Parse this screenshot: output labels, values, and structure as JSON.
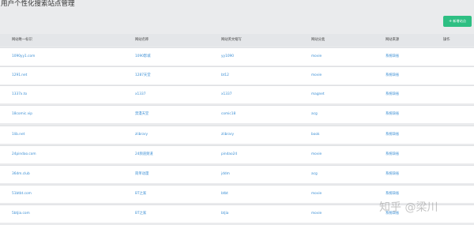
{
  "page": {
    "title": "用户个性化搜索站点管理"
  },
  "toolbar": {
    "add_label": "新增站点"
  },
  "table": {
    "columns": [
      "网站唯一标识",
      "网站名称",
      "网站英文缩写",
      "网站分类",
      "网站来源",
      "操作"
    ],
    "rows": [
      [
        "1090yy1.com",
        "1090影城",
        "yy1090",
        "movie",
        "系统缺省",
        ""
      ],
      [
        "1291.net",
        "1287天堂",
        "bt12",
        "movie",
        "系统缺省",
        ""
      ],
      [
        "1337x.to",
        "x1337",
        "x1337",
        "magnet",
        "系统缺省",
        ""
      ],
      [
        "18comic.vip",
        "禁漫天堂",
        "comic18",
        "acg",
        "系统缺省",
        ""
      ],
      [
        "1lib.net",
        "zlibrary",
        "zlibrary",
        "book",
        "系统缺省",
        ""
      ],
      [
        "24pindao.com",
        "24频道频道",
        "pindao24",
        "movie",
        "系统缺省",
        ""
      ],
      [
        "36dm.club",
        "简单动漫",
        "jddm",
        "acg",
        "系统缺省",
        ""
      ],
      [
        "51btbt.com",
        "BT之家",
        "btbt",
        "movie",
        "系统缺省",
        ""
      ],
      [
        "5btjia.com",
        "BT之家",
        "btjia",
        "movie",
        "系统缺省",
        ""
      ]
    ]
  },
  "watermark": {
    "text": "知乎 @梁川"
  },
  "colors": {
    "accent": "#2ebf83",
    "link": "#3a8ed4",
    "background": "#eaebed"
  }
}
